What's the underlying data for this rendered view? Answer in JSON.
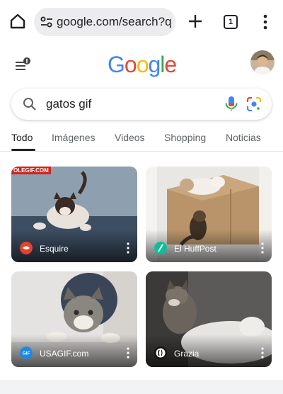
{
  "browser": {
    "url": "google.com/search?q",
    "tab_count": "1"
  },
  "google": {
    "logo": [
      "G",
      "o",
      "o",
      "g",
      "l",
      "e"
    ],
    "logo_colors": [
      "#4285F4",
      "#EA4335",
      "#FBBC05",
      "#4285F4",
      "#34A853",
      "#EA4335"
    ]
  },
  "search": {
    "query": "gatos gif"
  },
  "tabs": [
    {
      "label": "Todo",
      "active": true
    },
    {
      "label": "Imágenes",
      "active": false
    },
    {
      "label": "Videos",
      "active": false
    },
    {
      "label": "Shopping",
      "active": false
    },
    {
      "label": "Noticias",
      "active": false
    }
  ],
  "results": [
    {
      "source": "Esquire",
      "icon": "esquire-icon",
      "icon_color": "#e8402a"
    },
    {
      "source": "El HuffPost",
      "icon": "huffpost-icon",
      "icon_color": "#0dbe98"
    },
    {
      "source": "USAGIF.com",
      "icon": "usagif-icon",
      "icon_color": "#1e88e5",
      "icon_text": "GIF"
    },
    {
      "source": "Grazia",
      "icon": "grazia-icon",
      "icon_color": "#111111"
    }
  ],
  "watermark": "OLEGIF.COM"
}
